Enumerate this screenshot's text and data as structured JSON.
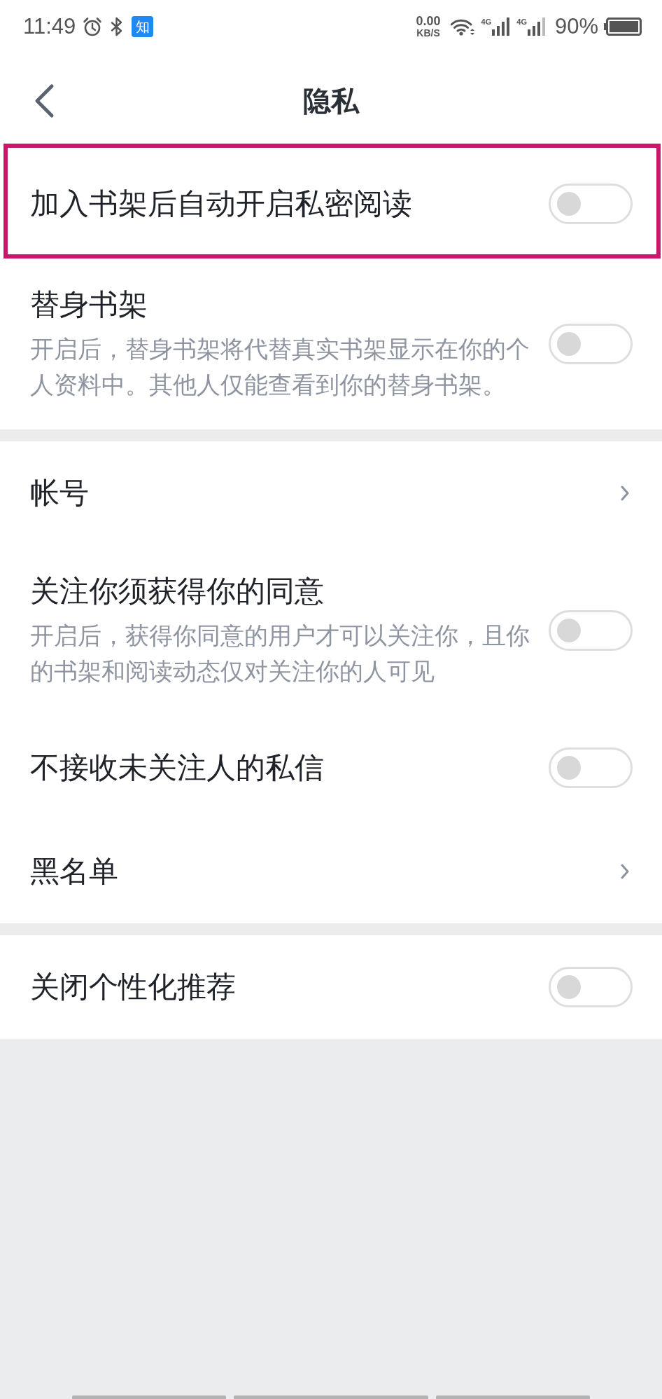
{
  "status_bar": {
    "time": "11:49",
    "notification_badge": "知",
    "net_speed": {
      "value": "0.00",
      "unit": "KB/S"
    },
    "sim_labels": [
      "4G",
      "4G"
    ],
    "battery": "90%"
  },
  "header": {
    "title": "隐私"
  },
  "sections": [
    {
      "items": [
        {
          "kind": "toggle",
          "label": "加入书架后自动开启私密阅读",
          "on": false,
          "highlighted": true
        },
        {
          "kind": "toggle",
          "label": "替身书架",
          "description": "开启后，替身书架将代替真实书架显示在你的个人资料中。其他人仅能查看到你的替身书架。",
          "on": false,
          "highlighted": false
        }
      ]
    },
    {
      "items": [
        {
          "kind": "link",
          "label": "帐号",
          "highlighted": false
        },
        {
          "kind": "toggle",
          "label": "关注你须获得你的同意",
          "description": "开启后，获得你同意的用户才可以关注你，且你的书架和阅读动态仅对关注你的人可见",
          "on": false,
          "highlighted": false
        },
        {
          "kind": "toggle",
          "label": "不接收未关注人的私信",
          "on": false,
          "highlighted": false
        },
        {
          "kind": "link",
          "label": "黑名单",
          "highlighted": false
        }
      ]
    },
    {
      "items": [
        {
          "kind": "toggle",
          "label": "关闭个性化推荐",
          "on": false,
          "highlighted": false
        }
      ]
    }
  ]
}
